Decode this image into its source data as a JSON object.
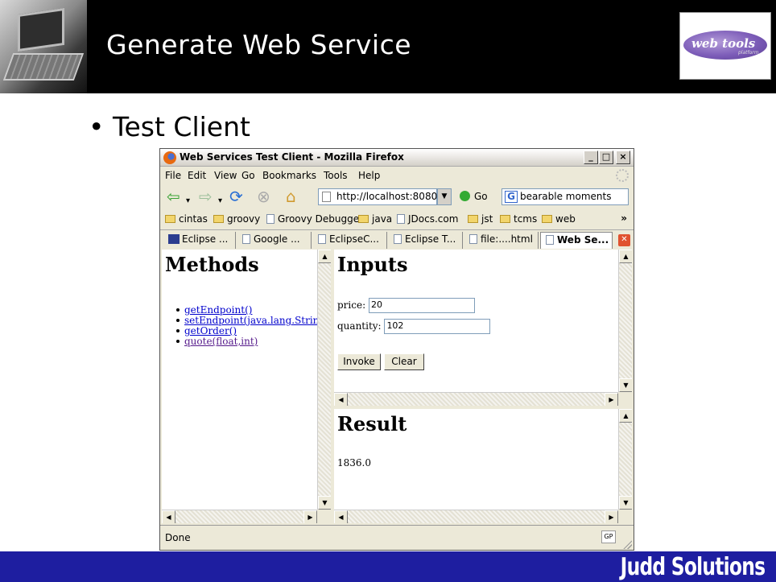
{
  "slide": {
    "title": "Generate Web Service",
    "bullet": "• Test Client",
    "logo_text": "web tools",
    "logo_sub": "platform",
    "footer_brand": "Judd Solutions"
  },
  "browser": {
    "window_title": "Web Services Test Client - Mozilla Firefox",
    "window_buttons": [
      "_",
      "□",
      "×"
    ],
    "menu": [
      "File",
      "Edit",
      "View",
      "Go",
      "Bookmarks",
      "Tools",
      "Help"
    ],
    "url": "http://localhost:8080",
    "go_label": "Go",
    "search_value": "bearable moments",
    "bookmarks": [
      {
        "label": "cintas",
        "type": "folder"
      },
      {
        "label": "groovy",
        "type": "folder"
      },
      {
        "label": "Groovy Debugger",
        "type": "page"
      },
      {
        "label": "java",
        "type": "folder"
      },
      {
        "label": "JDocs.com",
        "type": "page"
      },
      {
        "label": "jst",
        "type": "folder"
      },
      {
        "label": "tcms",
        "type": "folder"
      },
      {
        "label": "web",
        "type": "folder"
      }
    ],
    "bookmarks_more": "»",
    "tabs": [
      {
        "label": "Eclipse ...",
        "icon": "eclipse-icon"
      },
      {
        "label": "Google ...",
        "icon": "page-icon"
      },
      {
        "label": "EclipseC...",
        "icon": "page-icon"
      },
      {
        "label": "Eclipse T...",
        "icon": "page-icon"
      },
      {
        "label": "file:....html",
        "icon": "page-icon"
      },
      {
        "label": "Web Se...",
        "icon": "page-icon",
        "active": true
      }
    ],
    "status": "Done",
    "status_badge": "GP"
  },
  "methods": {
    "heading": "Methods",
    "items": [
      "getEndpoint()",
      "setEndpoint(java.lang.Strin",
      "getOrder()",
      "quote(float,int)"
    ]
  },
  "inputs": {
    "heading": "Inputs",
    "price_label": "price:",
    "price_value": "20",
    "quantity_label": "quantity:",
    "quantity_value": "102",
    "invoke_label": "Invoke",
    "clear_label": "Clear"
  },
  "result": {
    "heading": "Result",
    "value": "1836.0"
  },
  "colors": {
    "footer": "#1e1ea0",
    "header": "#000000",
    "link": "#0000cc",
    "visited_link": "#551a8b"
  }
}
